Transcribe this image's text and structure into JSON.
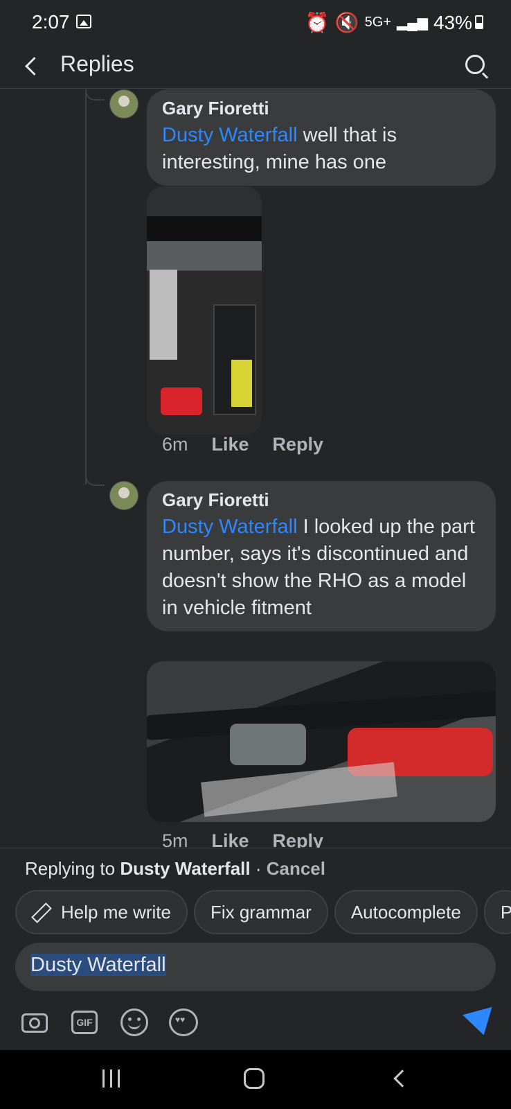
{
  "status_bar": {
    "time": "2:07",
    "network": "5G+",
    "battery": "43%"
  },
  "header": {
    "title": "Replies"
  },
  "comments": [
    {
      "author": "Gary Fioretti",
      "mention": "Dusty Waterfall",
      "text": " well that is interesting, mine has one",
      "time": "6m",
      "like_label": "Like",
      "reply_label": "Reply"
    },
    {
      "author": "Gary Fioretti",
      "mention": "Dusty Waterfall",
      "text": " I looked up the part number, says it's discontinued and doesn't show the RHO as a model in vehicle fitment",
      "time": "5m",
      "like_label": "Like",
      "reply_label": "Reply"
    }
  ],
  "composer": {
    "replying_prefix": "Replying to ",
    "replying_name": "Dusty Waterfall",
    "separator": " · ",
    "cancel_label": "Cancel",
    "chips": [
      "Help me write",
      "Fix grammar",
      "Autocomplete",
      "P"
    ],
    "input_value": "Dusty Waterfall",
    "gif_label": "GIF"
  },
  "icons": {
    "status": [
      "gallery-icon",
      "alarm-icon",
      "mute-icon",
      "signal-icon",
      "battery-icon"
    ],
    "header": [
      "back-icon",
      "search-icon"
    ],
    "composer": [
      "camera-icon",
      "gif-icon",
      "emoji-icon",
      "avatar-sticker-icon",
      "send-icon"
    ],
    "nav": [
      "recent-apps-icon",
      "home-icon",
      "back-nav-icon"
    ]
  },
  "colors": {
    "background": "#242526",
    "bubble": "#3a3b3c",
    "mention": "#2d88ff",
    "secondary_text": "#b0b3b8"
  }
}
